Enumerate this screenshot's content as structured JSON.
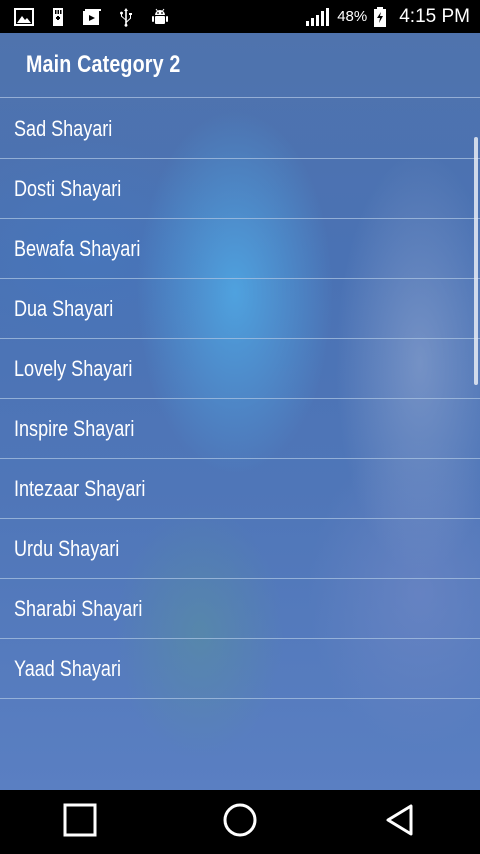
{
  "status_bar": {
    "battery_percent": "48%",
    "time": "4:15 PM",
    "left_icons": [
      "image-icon",
      "sd-card-icon",
      "media-icon",
      "usb-icon",
      "android-debug-icon"
    ],
    "right_icons": [
      "signal-icon",
      "battery-icon"
    ]
  },
  "header": {
    "title": "Main Category 2"
  },
  "list": {
    "items": [
      {
        "label": "Sad Shayari"
      },
      {
        "label": "Dosti Shayari"
      },
      {
        "label": "Bewafa Shayari"
      },
      {
        "label": "Dua Shayari"
      },
      {
        "label": "Lovely Shayari"
      },
      {
        "label": "Inspire Shayari"
      },
      {
        "label": "Intezaar Shayari"
      },
      {
        "label": "Urdu Shayari"
      },
      {
        "label": "Sharabi Shayari"
      },
      {
        "label": "Yaad Shayari"
      }
    ]
  },
  "nav_bar": {
    "buttons": [
      "recent-apps-icon",
      "home-icon",
      "back-icon"
    ]
  },
  "colors": {
    "status_bar_bg": "#000000",
    "nav_bar_bg": "#000000",
    "list_text": "#ffffff",
    "background_blue": "#4f76b8"
  }
}
